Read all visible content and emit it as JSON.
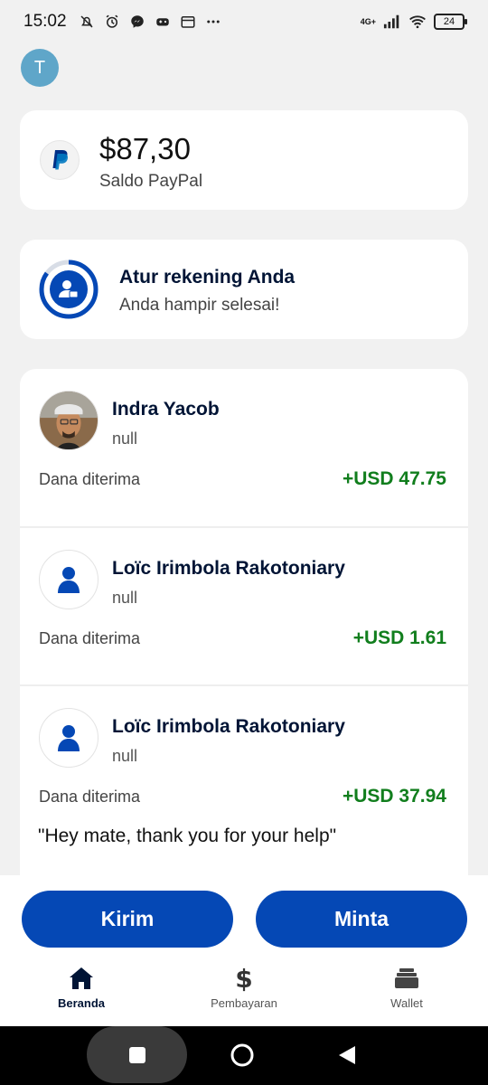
{
  "status_bar": {
    "time": "15:02",
    "network": "4G+",
    "battery": "24",
    "icons": [
      "bell-off-icon",
      "alarm-icon",
      "messenger-icon",
      "game-icon",
      "calendar-icon",
      "more-icon"
    ]
  },
  "profile": {
    "initial": "T"
  },
  "balance": {
    "amount": "$87,30",
    "label": "Saldo PayPal"
  },
  "setup": {
    "title": "Atur rekening Anda",
    "subtitle": "Anda hampir selesai!",
    "progress": 0.85
  },
  "transactions": [
    {
      "name": "Indra Yacob",
      "sub": "null",
      "status": "Dana diterima",
      "amount": "+USD 47.75",
      "note": "",
      "avatar": "photo"
    },
    {
      "name": "Loïc Irimbola Rakotoniary",
      "sub": "null",
      "status": "Dana diterima",
      "amount": "+USD 1.61",
      "note": "",
      "avatar": "person-icon"
    },
    {
      "name": "Loïc Irimbola Rakotoniary",
      "sub": "null",
      "status": "Dana diterima",
      "amount": "+USD 37.94",
      "note": "\"Hey mate, thank you for your help\"",
      "avatar": "person-icon"
    }
  ],
  "actions": {
    "send_label": "Kirim",
    "request_label": "Minta"
  },
  "nav": {
    "items": [
      {
        "label": "Beranda",
        "icon": "home-icon",
        "active": true
      },
      {
        "label": "Pembayaran",
        "icon": "dollar-icon",
        "active": false
      },
      {
        "label": "Wallet",
        "icon": "wallet-icon",
        "active": false
      }
    ]
  },
  "colors": {
    "primary": "#0548b5",
    "navy": "#001435",
    "positive": "#117e1d",
    "avatar": "#5fa6c9"
  }
}
